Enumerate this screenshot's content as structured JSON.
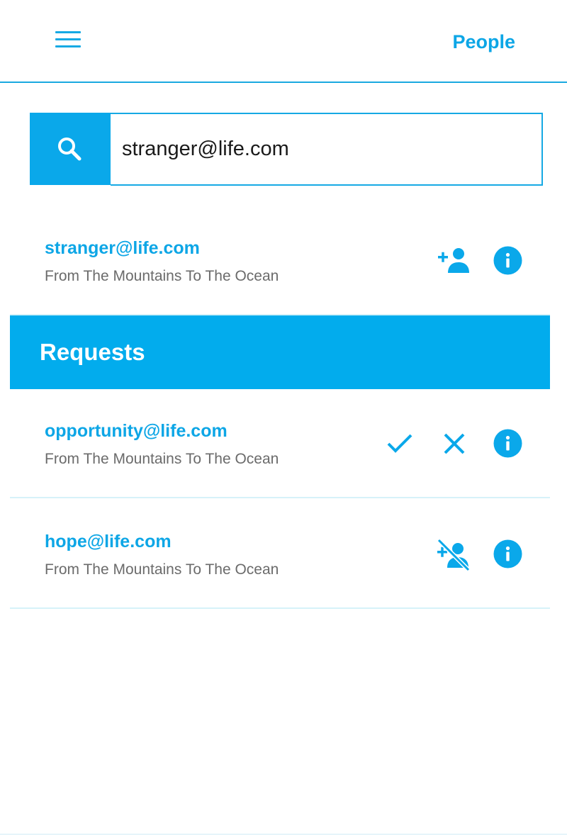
{
  "header": {
    "title": "People"
  },
  "search": {
    "value": "stranger@life.com",
    "placeholder": ""
  },
  "search_result": {
    "email": "stranger@life.com",
    "subtitle": "From The Mountains To The Ocean"
  },
  "requests": {
    "title": "Requests",
    "items": [
      {
        "email": "opportunity@life.com",
        "subtitle": "From The Mountains To The Ocean"
      },
      {
        "email": "hope@life.com",
        "subtitle": "From The Mountains To The Ocean"
      }
    ]
  },
  "colors": {
    "accent": "#0aa8ea",
    "bar": "#02aced",
    "text_secondary": "#6b6b6b",
    "divider": "#d6f2f9"
  }
}
